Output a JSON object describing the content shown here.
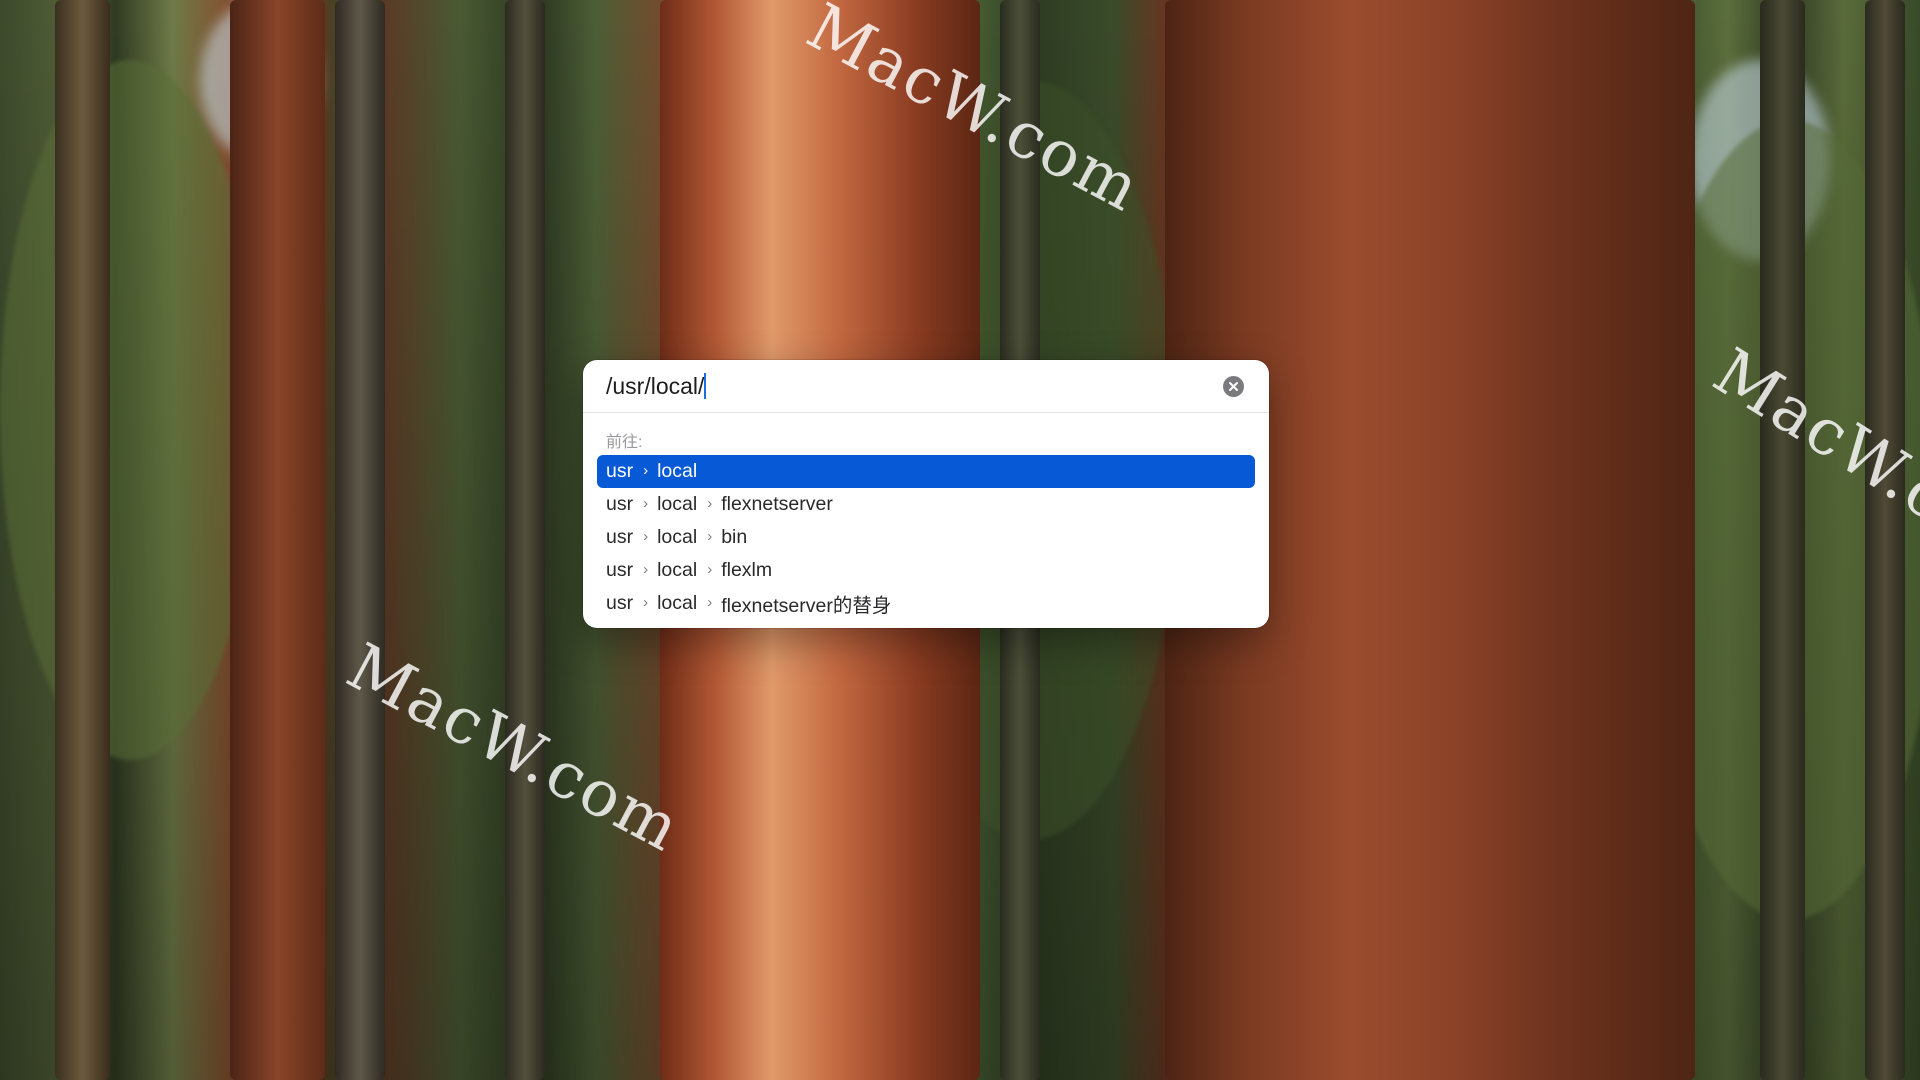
{
  "dialog": {
    "path_value": "/usr/local/",
    "clear_icon": "xmark-circle-icon",
    "section_label": "前往:"
  },
  "results": [
    {
      "selected": true,
      "segments": [
        "usr",
        "local"
      ]
    },
    {
      "selected": false,
      "segments": [
        "usr",
        "local",
        "flexnetserver"
      ]
    },
    {
      "selected": false,
      "segments": [
        "usr",
        "local",
        "bin"
      ]
    },
    {
      "selected": false,
      "segments": [
        "usr",
        "local",
        "flexlm"
      ]
    },
    {
      "selected": false,
      "segments": [
        "usr",
        "local",
        "flexnetserver的替身"
      ]
    }
  ],
  "separator_icon": "chevron-right-icon",
  "watermarks": [
    "MacW.com",
    "MacW.com",
    "MacW.co"
  ],
  "colors": {
    "selection": "#0859d6",
    "caret": "#1a6fe3"
  }
}
